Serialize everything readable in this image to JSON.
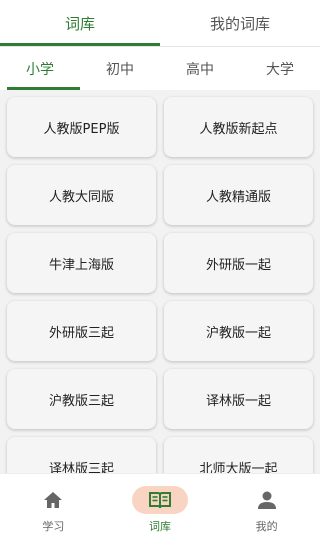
{
  "top_tabs": [
    {
      "label": "词库",
      "active": true
    },
    {
      "label": "我的词库",
      "active": false
    }
  ],
  "level_tabs": [
    {
      "label": "小学",
      "active": true
    },
    {
      "label": "初中",
      "active": false
    },
    {
      "label": "高中",
      "active": false
    },
    {
      "label": "大学",
      "active": false
    }
  ],
  "textbooks": [
    "人教版PEP版",
    "人教版新起点",
    "人教大同版",
    "人教精通版",
    "牛津上海版",
    "外研版一起",
    "外研版三起",
    "沪教版一起",
    "沪教版三起",
    "译林版一起",
    "译林版三起",
    "北师大版一起"
  ],
  "bottom_nav": [
    {
      "label": "学习",
      "icon": "home-icon",
      "active": false
    },
    {
      "label": "词库",
      "icon": "book-icon",
      "active": true
    },
    {
      "label": "我的",
      "icon": "user-icon",
      "active": false
    }
  ],
  "colors": {
    "accent": "#2e7d32",
    "active_nav_bg": "#fad4c2",
    "card_bg": "#f5f5f5",
    "content_bg": "#f2f2f2"
  }
}
